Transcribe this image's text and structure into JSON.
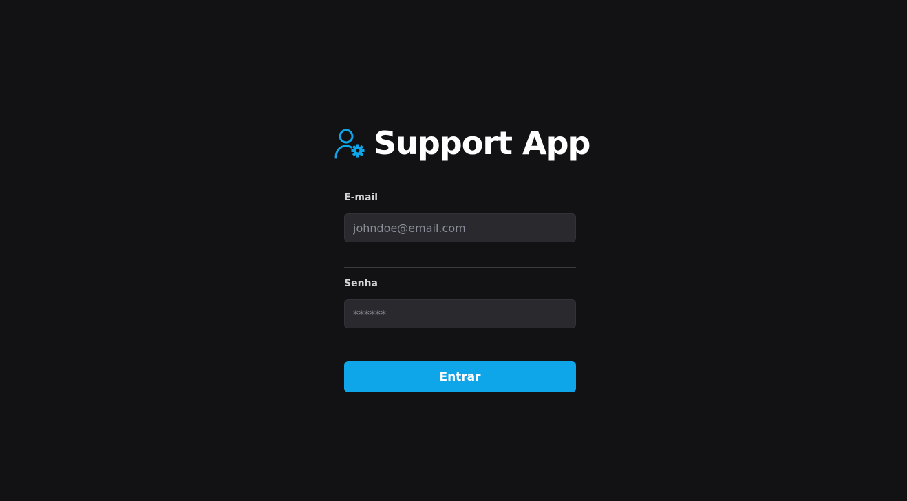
{
  "app": {
    "title": "Support App",
    "logo_icon": "user-gear-icon"
  },
  "form": {
    "email": {
      "label": "E-mail",
      "placeholder": "johndoe@email.com",
      "value": ""
    },
    "password": {
      "label": "Senha",
      "placeholder": "******",
      "value": ""
    },
    "submit_label": "Entrar"
  },
  "colors": {
    "background": "#121214",
    "accent": "#0ea5e9",
    "input_background": "#29292e",
    "text": "#ffffff"
  }
}
